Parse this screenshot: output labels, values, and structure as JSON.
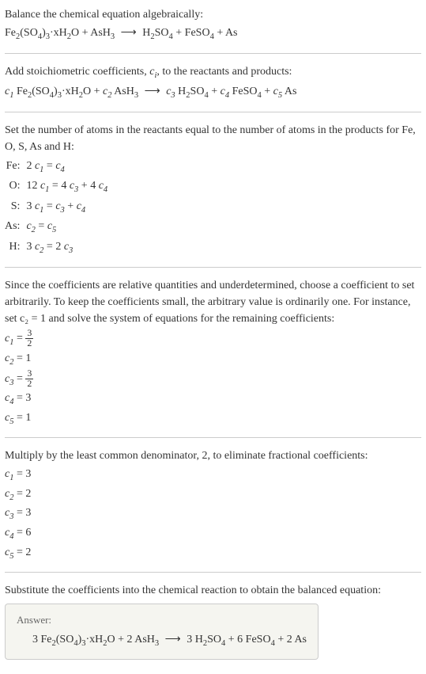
{
  "intro": {
    "line1": "Balance the chemical equation algebraically:",
    "eq1_lhs": "Fe₂(SO₄)₃·xH₂O + AsH₃",
    "eq1_rhs": "H₂SO₄ + FeSO₄ + As"
  },
  "stoich": {
    "line1_a": "Add stoichiometric coefficients, ",
    "line1_b": ", to the reactants and products:",
    "ci": "c",
    "ci_sub": "i",
    "eq_lhs_c1": "c₁",
    "eq_r1": " Fe₂(SO₄)₃·xH₂O + ",
    "eq_lhs_c2": "c₂",
    "eq_r2": " AsH₃",
    "eq_rhs_c3": "c₃",
    "eq_p1": " H₂SO₄ + ",
    "eq_rhs_c4": "c₄",
    "eq_p2": " FeSO₄ + ",
    "eq_rhs_c5": "c₅",
    "eq_p3": " As"
  },
  "atoms": {
    "intro": "Set the number of atoms in the reactants equal to the number of atoms in the products for Fe, O, S, As and H:",
    "rows": [
      {
        "el": "Fe:",
        "eq": "2 c₁ = c₄"
      },
      {
        "el": "O:",
        "eq": "12 c₁ = 4 c₃ + 4 c₄"
      },
      {
        "el": "S:",
        "eq": "3 c₁ = c₃ + c₄"
      },
      {
        "el": "As:",
        "eq": "c₂ = c₅"
      },
      {
        "el": "H:",
        "eq": "3 c₂ = 2 c₃"
      }
    ]
  },
  "solve": {
    "intro": "Since the coefficients are relative quantities and underdetermined, choose a coefficient to set arbitrarily. To keep the coefficients small, the arbitrary value is ordinarily one. For instance, set c₂ = 1 and solve the system of equations for the remaining coefficients:",
    "c1_label": "c₁ = ",
    "c1_num": "3",
    "c1_den": "2",
    "c2": "c₂ = 1",
    "c3_label": "c₃ = ",
    "c3_num": "3",
    "c3_den": "2",
    "c4": "c₄ = 3",
    "c5": "c₅ = 1"
  },
  "multiply": {
    "intro": "Multiply by the least common denominator, 2, to eliminate fractional coefficients:",
    "c1": "c₁ = 3",
    "c2": "c₂ = 2",
    "c3": "c₃ = 3",
    "c4": "c₄ = 6",
    "c5": "c₅ = 2"
  },
  "final": {
    "intro": "Substitute the coefficients into the chemical reaction to obtain the balanced equation:",
    "answer_label": "Answer:",
    "eq_lhs": "3 Fe₂(SO₄)₃·xH₂O + 2 AsH₃",
    "eq_rhs": "3 H₂SO₄ + 6 FeSO₄ + 2 As"
  },
  "chart_data": {
    "type": "table",
    "title": "Chemical equation balancing",
    "unbalanced": "Fe2(SO4)3·xH2O + AsH3 -> H2SO4 + FeSO4 + As",
    "atom_equations": {
      "Fe": "2 c1 = c4",
      "O": "12 c1 = 4 c3 + 4 c4",
      "S": "3 c1 = c3 + c4",
      "As": "c2 = c5",
      "H": "3 c2 = 2 c3"
    },
    "solution_c2_1": {
      "c1": 1.5,
      "c2": 1,
      "c3": 1.5,
      "c4": 3,
      "c5": 1
    },
    "integer_solution": {
      "c1": 3,
      "c2": 2,
      "c3": 3,
      "c4": 6,
      "c5": 2
    },
    "balanced": "3 Fe2(SO4)3·xH2O + 2 AsH3 -> 3 H2SO4 + 6 FeSO4 + 2 As"
  }
}
